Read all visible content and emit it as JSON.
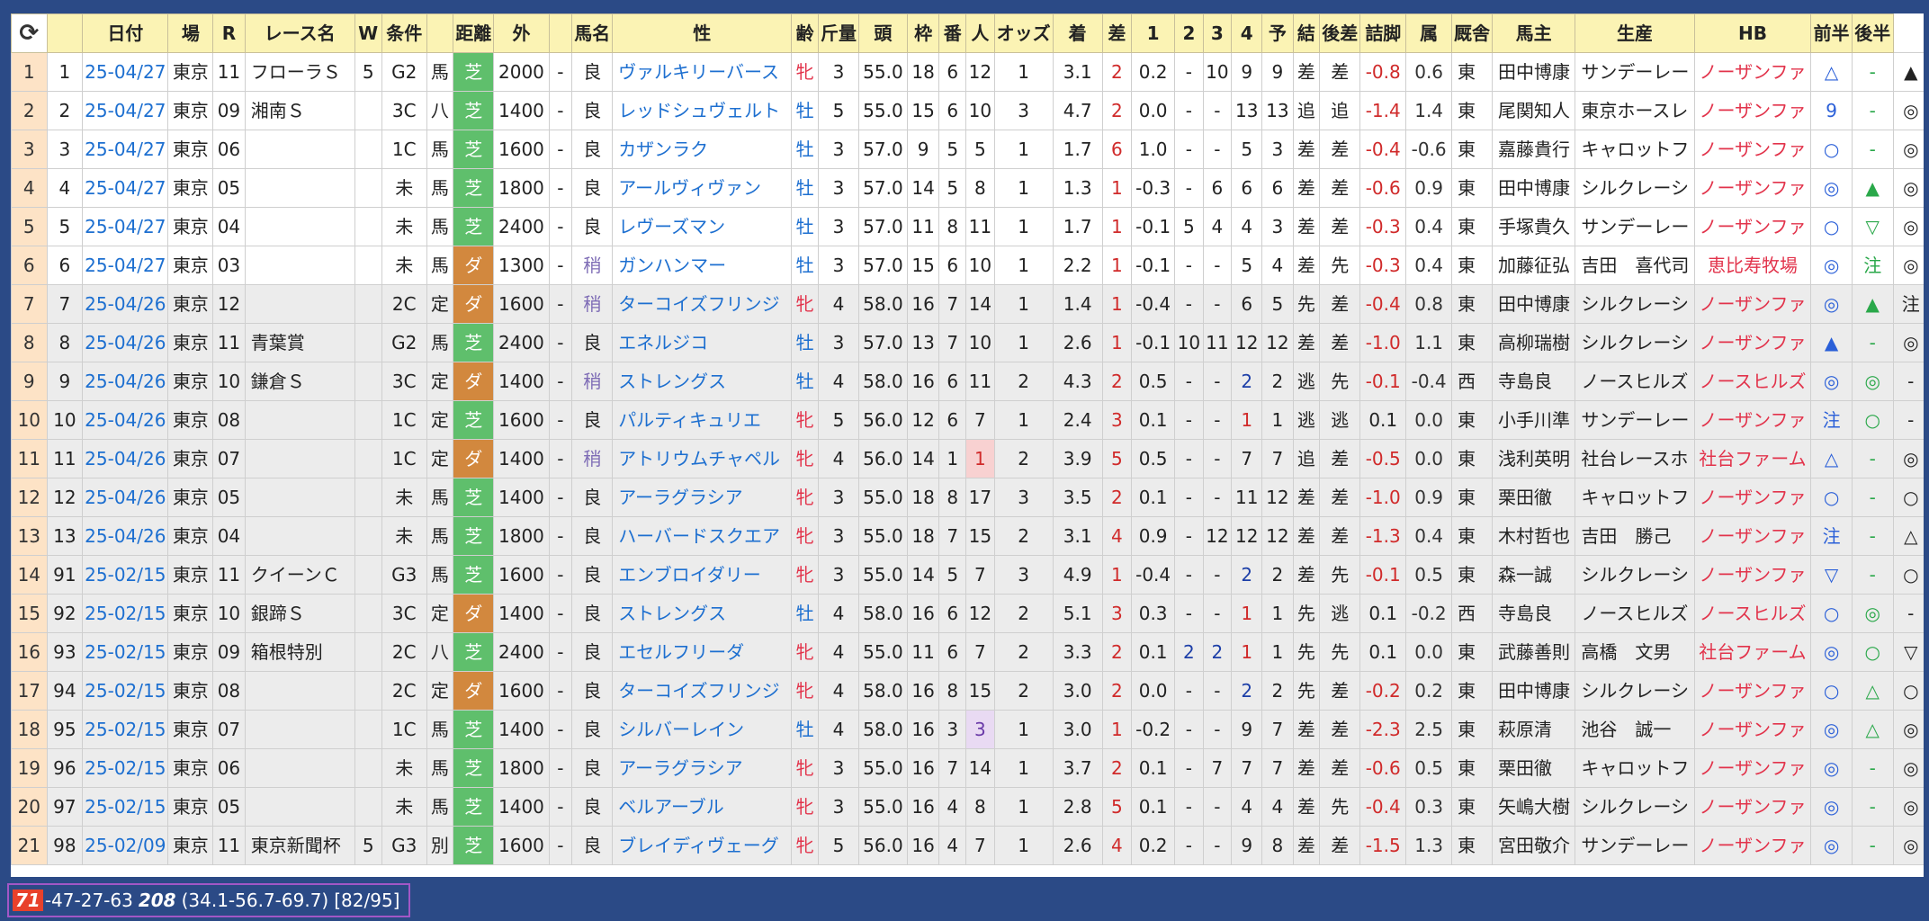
{
  "headers": [
    "⟳",
    "",
    "日付",
    "場",
    "R",
    "レース名",
    "W",
    "条件",
    "",
    "距離",
    "外",
    "",
    "馬名",
    "性",
    "齢",
    "斤量",
    "頭",
    "枠",
    "番",
    "人",
    "オッズ",
    "着",
    "差",
    "1",
    "2",
    "3",
    "4",
    "予",
    "結",
    "後差",
    "詰脚",
    "属",
    "厩舎",
    "馬主",
    "生産",
    "HB",
    "前半",
    "後半"
  ],
  "rows": [
    [
      "1",
      "1",
      "25-04/27",
      "東京",
      "11",
      "フローラＳ",
      "5",
      "G2",
      "馬",
      "芝",
      "2000",
      "-",
      "良",
      "ヴァルキリーバース",
      "牝",
      "3",
      "55.0",
      "18",
      "6",
      "12",
      "1",
      "3.1",
      "2",
      "0.2",
      "-",
      "10",
      "9",
      "9",
      "差",
      "差",
      "-0.8",
      "0.6",
      "東",
      "田中博康",
      "サンデーレー",
      "ノーザンファ",
      "△",
      "-",
      "▲"
    ],
    [
      "2",
      "2",
      "25-04/27",
      "東京",
      "09",
      "湘南Ｓ",
      "",
      "3C",
      "八",
      "芝",
      "1400",
      "-",
      "良",
      "レッドシュヴェルト",
      "牡",
      "5",
      "55.0",
      "15",
      "6",
      "10",
      "3",
      "4.7",
      "2",
      "0.0",
      "-",
      "-",
      "13",
      "13",
      "追",
      "追",
      "-1.4",
      "1.4",
      "東",
      "尾関知人",
      "東京ホースレ",
      "ノーザンファ",
      "9",
      "-",
      "◎"
    ],
    [
      "3",
      "3",
      "25-04/27",
      "東京",
      "06",
      "",
      "",
      "1C",
      "馬",
      "芝",
      "1600",
      "-",
      "良",
      "カザンラク",
      "牡",
      "3",
      "57.0",
      "9",
      "5",
      "5",
      "1",
      "1.7",
      "6",
      "1.0",
      "-",
      "-",
      "5",
      "3",
      "差",
      "差",
      "-0.4",
      "-0.6",
      "東",
      "嘉藤貴行",
      "キャロットフ",
      "ノーザンファ",
      "○",
      "-",
      "◎"
    ],
    [
      "4",
      "4",
      "25-04/27",
      "東京",
      "05",
      "",
      "",
      "未",
      "馬",
      "芝",
      "1800",
      "-",
      "良",
      "アールヴィヴァン",
      "牡",
      "3",
      "57.0",
      "14",
      "5",
      "8",
      "1",
      "1.3",
      "1",
      "-0.3",
      "-",
      "6",
      "6",
      "6",
      "差",
      "差",
      "-0.6",
      "0.9",
      "東",
      "田中博康",
      "シルクレーシ",
      "ノーザンファ",
      "◎",
      "▲",
      "◎"
    ],
    [
      "5",
      "5",
      "25-04/27",
      "東京",
      "04",
      "",
      "",
      "未",
      "馬",
      "芝",
      "2400",
      "-",
      "良",
      "レヴーズマン",
      "牡",
      "3",
      "57.0",
      "11",
      "8",
      "11",
      "1",
      "1.7",
      "1",
      "-0.1",
      "5",
      "4",
      "4",
      "3",
      "差",
      "差",
      "-0.3",
      "0.4",
      "東",
      "手塚貴久",
      "サンデーレー",
      "ノーザンファ",
      "○",
      "▽",
      "◎"
    ],
    [
      "6",
      "6",
      "25-04/27",
      "東京",
      "03",
      "",
      "",
      "未",
      "馬",
      "ダ",
      "1300",
      "-",
      "稍",
      "ガンハンマー",
      "牡",
      "3",
      "57.0",
      "15",
      "6",
      "10",
      "1",
      "2.2",
      "1",
      "-0.1",
      "-",
      "-",
      "5",
      "4",
      "差",
      "先",
      "-0.3",
      "0.4",
      "東",
      "加藤征弘",
      "吉田　喜代司",
      "恵比寿牧場",
      "◎",
      "注",
      "◎"
    ],
    [
      "7",
      "7",
      "25-04/26",
      "東京",
      "12",
      "",
      "",
      "2C",
      "定",
      "ダ",
      "1600",
      "-",
      "稍",
      "ターコイズフリンジ",
      "牝",
      "4",
      "58.0",
      "16",
      "7",
      "14",
      "1",
      "1.4",
      "1",
      "-0.4",
      "-",
      "-",
      "6",
      "5",
      "先",
      "差",
      "-0.4",
      "0.8",
      "東",
      "田中博康",
      "シルクレーシ",
      "ノーザンファ",
      "◎",
      "▲",
      "注"
    ],
    [
      "8",
      "8",
      "25-04/26",
      "東京",
      "11",
      "青葉賞",
      "",
      "G2",
      "馬",
      "芝",
      "2400",
      "-",
      "良",
      "エネルジコ",
      "牡",
      "3",
      "57.0",
      "13",
      "7",
      "10",
      "1",
      "2.6",
      "1",
      "-0.1",
      "10",
      "11",
      "12",
      "12",
      "差",
      "差",
      "-1.0",
      "1.1",
      "東",
      "高柳瑞樹",
      "シルクレーシ",
      "ノーザンファ",
      "▲",
      "-",
      "◎"
    ],
    [
      "9",
      "9",
      "25-04/26",
      "東京",
      "10",
      "鎌倉Ｓ",
      "",
      "3C",
      "定",
      "ダ",
      "1400",
      "-",
      "稍",
      "ストレングス",
      "牡",
      "4",
      "58.0",
      "16",
      "6",
      "11",
      "2",
      "4.3",
      "2",
      "0.5",
      "-",
      "-",
      "2",
      "2",
      "逃",
      "先",
      "-0.1",
      "-0.4",
      "西",
      "寺島良",
      "ノースヒルズ",
      "ノースヒルズ",
      "◎",
      "◎",
      "-"
    ],
    [
      "10",
      "10",
      "25-04/26",
      "東京",
      "08",
      "",
      "",
      "1C",
      "定",
      "芝",
      "1600",
      "-",
      "良",
      "パルティキュリエ",
      "牝",
      "5",
      "56.0",
      "12",
      "6",
      "7",
      "1",
      "2.4",
      "3",
      "0.1",
      "-",
      "-",
      "1",
      "1",
      "逃",
      "逃",
      "0.1",
      "0.0",
      "東",
      "小手川準",
      "サンデーレー",
      "ノーザンファ",
      "注",
      "○",
      "-"
    ],
    [
      "11",
      "11",
      "25-04/26",
      "東京",
      "07",
      "",
      "",
      "1C",
      "定",
      "ダ",
      "1400",
      "-",
      "稍",
      "アトリウムチャペル",
      "牝",
      "4",
      "56.0",
      "14",
      "1",
      "1",
      "2",
      "3.9",
      "5",
      "0.5",
      "-",
      "-",
      "7",
      "7",
      "追",
      "差",
      "-0.5",
      "0.0",
      "東",
      "浅利英明",
      "社台レースホ",
      "社台ファーム",
      "△",
      "-",
      "◎"
    ],
    [
      "12",
      "12",
      "25-04/26",
      "東京",
      "05",
      "",
      "",
      "未",
      "馬",
      "芝",
      "1400",
      "-",
      "良",
      "アーラグラシア",
      "牝",
      "3",
      "55.0",
      "18",
      "8",
      "17",
      "3",
      "3.5",
      "2",
      "0.1",
      "-",
      "-",
      "11",
      "12",
      "差",
      "差",
      "-1.0",
      "0.9",
      "東",
      "栗田徹",
      "キャロットフ",
      "ノーザンファ",
      "○",
      "-",
      "○"
    ],
    [
      "13",
      "13",
      "25-04/26",
      "東京",
      "04",
      "",
      "",
      "未",
      "馬",
      "芝",
      "1800",
      "-",
      "良",
      "ハーバードスクエア",
      "牝",
      "3",
      "55.0",
      "18",
      "7",
      "15",
      "2",
      "3.1",
      "4",
      "0.9",
      "-",
      "12",
      "12",
      "12",
      "差",
      "差",
      "-1.3",
      "0.4",
      "東",
      "木村哲也",
      "吉田　勝己",
      "ノーザンファ",
      "注",
      "-",
      "△"
    ],
    [
      "14",
      "91",
      "25-02/15",
      "東京",
      "11",
      "クイーンＣ",
      "",
      "G3",
      "馬",
      "芝",
      "1600",
      "-",
      "良",
      "エンブロイダリー",
      "牝",
      "3",
      "55.0",
      "14",
      "5",
      "7",
      "3",
      "4.9",
      "1",
      "-0.4",
      "-",
      "-",
      "2",
      "2",
      "差",
      "先",
      "-0.1",
      "0.5",
      "東",
      "森一誠",
      "シルクレーシ",
      "ノーザンファ",
      "▽",
      "-",
      "○"
    ],
    [
      "15",
      "92",
      "25-02/15",
      "東京",
      "10",
      "銀蹄Ｓ",
      "",
      "3C",
      "定",
      "ダ",
      "1400",
      "-",
      "良",
      "ストレングス",
      "牡",
      "4",
      "58.0",
      "16",
      "6",
      "12",
      "2",
      "5.1",
      "3",
      "0.3",
      "-",
      "-",
      "1",
      "1",
      "先",
      "逃",
      "0.1",
      "-0.2",
      "西",
      "寺島良",
      "ノースヒルズ",
      "ノースヒルズ",
      "○",
      "◎",
      "-"
    ],
    [
      "16",
      "93",
      "25-02/15",
      "東京",
      "09",
      "箱根特別",
      "",
      "2C",
      "八",
      "芝",
      "2400",
      "-",
      "良",
      "エセルフリーダ",
      "牝",
      "4",
      "55.0",
      "11",
      "6",
      "7",
      "2",
      "3.3",
      "2",
      "0.1",
      "2",
      "2",
      "1",
      "1",
      "先",
      "先",
      "0.1",
      "0.0",
      "東",
      "武藤善則",
      "高橋　文男",
      "社台ファーム",
      "◎",
      "○",
      "▽"
    ],
    [
      "17",
      "94",
      "25-02/15",
      "東京",
      "08",
      "",
      "",
      "2C",
      "定",
      "ダ",
      "1600",
      "-",
      "良",
      "ターコイズフリンジ",
      "牝",
      "4",
      "58.0",
      "16",
      "8",
      "15",
      "2",
      "3.0",
      "2",
      "0.0",
      "-",
      "-",
      "2",
      "2",
      "先",
      "差",
      "-0.2",
      "0.2",
      "東",
      "田中博康",
      "シルクレーシ",
      "ノーザンファ",
      "○",
      "△",
      "○"
    ],
    [
      "18",
      "95",
      "25-02/15",
      "東京",
      "07",
      "",
      "",
      "1C",
      "馬",
      "芝",
      "1400",
      "-",
      "良",
      "シルバーレイン",
      "牡",
      "4",
      "58.0",
      "16",
      "3",
      "3",
      "1",
      "3.0",
      "1",
      "-0.2",
      "-",
      "-",
      "9",
      "7",
      "差",
      "差",
      "-2.3",
      "2.5",
      "東",
      "萩原清",
      "池谷　誠一",
      "ノーザンファ",
      "◎",
      "△",
      "◎"
    ],
    [
      "19",
      "96",
      "25-02/15",
      "東京",
      "06",
      "",
      "",
      "未",
      "馬",
      "芝",
      "1800",
      "-",
      "良",
      "アーラグラシア",
      "牝",
      "3",
      "55.0",
      "16",
      "7",
      "14",
      "1",
      "3.7",
      "2",
      "0.1",
      "-",
      "7",
      "7",
      "7",
      "差",
      "差",
      "-0.6",
      "0.5",
      "東",
      "栗田徹",
      "キャロットフ",
      "ノーザンファ",
      "◎",
      "-",
      "◎"
    ],
    [
      "20",
      "97",
      "25-02/15",
      "東京",
      "05",
      "",
      "",
      "未",
      "馬",
      "芝",
      "1400",
      "-",
      "良",
      "ベルアーブル",
      "牝",
      "3",
      "55.0",
      "16",
      "4",
      "8",
      "1",
      "2.8",
      "5",
      "0.1",
      "-",
      "-",
      "4",
      "4",
      "差",
      "先",
      "-0.4",
      "0.3",
      "東",
      "矢嶋大樹",
      "シルクレーシ",
      "ノーザンファ",
      "◎",
      "-",
      "◎"
    ],
    [
      "21",
      "98",
      "25-02/09",
      "東京",
      "11",
      "東京新聞杯",
      "5",
      "G3",
      "別",
      "芝",
      "1600",
      "-",
      "良",
      "ブレイディヴェーグ",
      "牝",
      "5",
      "56.0",
      "16",
      "4",
      "7",
      "1",
      "2.6",
      "4",
      "0.2",
      "-",
      "-",
      "9",
      "8",
      "差",
      "差",
      "-1.5",
      "1.3",
      "東",
      "宮田敬介",
      "サンデーレー",
      "ノーザンファ",
      "◎",
      "-",
      "◎"
    ]
  ],
  "status": {
    "badge": "71",
    "record": "-47-27-63",
    "total": "208",
    "rates": "(34.1-56.7-69.7)",
    "fraction": "[82/95]"
  },
  "colors": {
    "waku": {
      "1": "#ffffff",
      "2": "#222222",
      "3": "#e03a3a",
      "4": "#2a67d8",
      "5": "#f2d23a",
      "6": "#2e9a48",
      "7": "#f28c22",
      "8": "#f07ac0"
    },
    "owner_highlight": "#a7a6ef"
  }
}
